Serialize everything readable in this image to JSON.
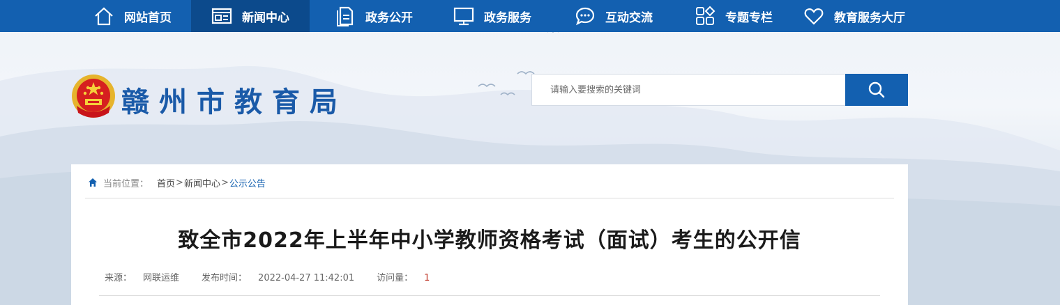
{
  "nav": {
    "items": [
      {
        "label": "网站首页",
        "icon": "home-icon"
      },
      {
        "label": "新闻中心",
        "icon": "news-icon"
      },
      {
        "label": "政务公开",
        "icon": "document-icon"
      },
      {
        "label": "政务服务",
        "icon": "monitor-icon"
      },
      {
        "label": "互动交流",
        "icon": "chat-icon"
      },
      {
        "label": "专题专栏",
        "icon": "grid-icon"
      },
      {
        "label": "教育服务大厅",
        "icon": "heart-icon"
      }
    ],
    "active_index": 1
  },
  "header": {
    "site_title": "赣州市教育局",
    "emblem_icon": "national-emblem-icon"
  },
  "search": {
    "placeholder": "请输入要搜索的关键词",
    "button_icon": "search-icon"
  },
  "breadcrumb": {
    "label": "当前位置：",
    "items": [
      "首页",
      "新闻中心",
      "公示公告"
    ],
    "separator": ">"
  },
  "article": {
    "title": "致全市2022年上半年中小学教师资格考试（面试）考生的公开信",
    "source_label": "来源：",
    "source_value": "网联运维",
    "time_label": "发布时间：",
    "time_value": "2022-04-27 11:42:01",
    "views_label": "访问量：",
    "views_value": "1"
  },
  "colors": {
    "primary": "#1360b0",
    "nav_active": "#0c4a8c",
    "title_blue": "#1a5aa8"
  }
}
